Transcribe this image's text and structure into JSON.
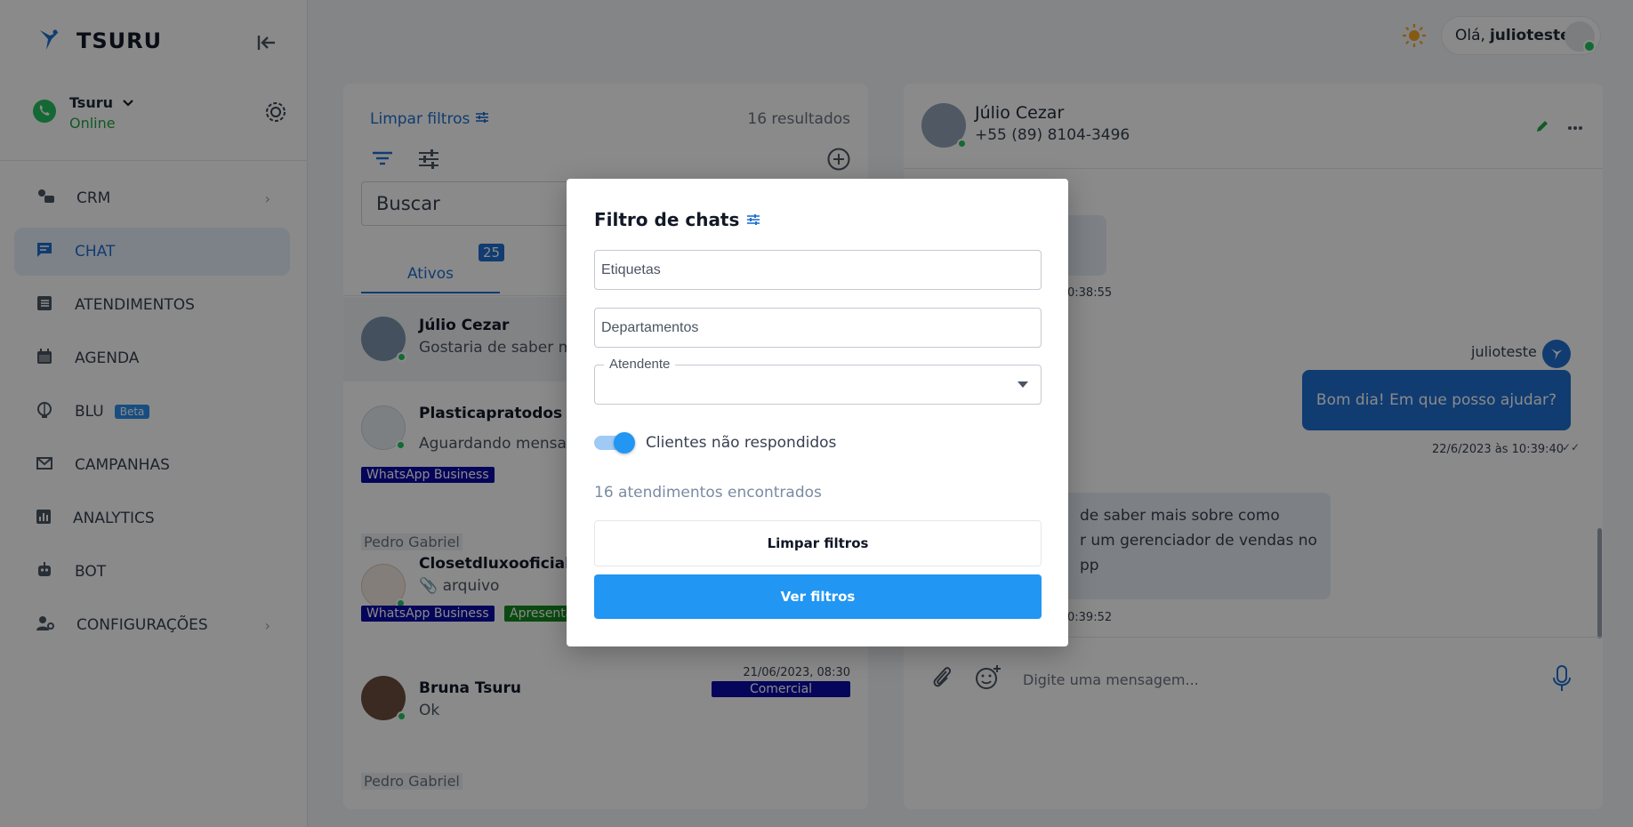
{
  "brand": {
    "name": "TSURU"
  },
  "account": {
    "name": "Tsuru",
    "status": "Online"
  },
  "nav": [
    {
      "label": "CRM",
      "icon": "crm-icon",
      "chevron": true
    },
    {
      "label": "CHAT",
      "icon": "chat-icon",
      "active": true
    },
    {
      "label": "ATENDIMENTOS",
      "icon": "list-icon"
    },
    {
      "label": "AGENDA",
      "icon": "calendar-icon"
    },
    {
      "label": "BLU",
      "icon": "brain-icon",
      "badge": "Beta"
    },
    {
      "label": "CAMPANHAS",
      "icon": "mail-icon"
    },
    {
      "label": "ANALYTICS",
      "icon": "analytics-icon"
    },
    {
      "label": "BOT",
      "icon": "bot-icon"
    },
    {
      "label": "CONFIGURAÇÕES",
      "icon": "users-gear-icon",
      "chevron": true
    }
  ],
  "header": {
    "greeting": "Olá,",
    "username": "julioteste"
  },
  "list": {
    "clear_filters": "Limpar filtros",
    "results": "16 resultados",
    "search_placeholder": "Buscar",
    "tab_active": "Ativos",
    "tab_active_count": "25",
    "chats": [
      {
        "name": "Júlio Cezar",
        "message": "Gostaria de saber ma"
      },
      {
        "name": "Plasticapratodos",
        "message": "Aguardando mensage",
        "tags": [
          "WhatsApp Business"
        ]
      },
      {
        "agent": "Pedro Gabriel",
        "name": "Closetdluxooficial",
        "message": "arquivo",
        "tags": [
          "WhatsApp Business",
          "Apresenta"
        ]
      },
      {
        "name": "Bruna Tsuru",
        "message": "Ok",
        "date": "21/06/2023, 08:30",
        "department": "Comercial"
      },
      {
        "agent": "Pedro Gabriel"
      }
    ]
  },
  "conversation": {
    "name": "Júlio Cezar",
    "phone": "+55 (89) 8104-3496",
    "msg1_fragment": "!",
    "msg1_time": "0:38:55",
    "sender": "julioteste",
    "out_message": "Bom dia! Em que posso ajudar?",
    "out_time": "22/6/2023 às 10:39:40",
    "msg2_lines": [
      "de saber mais sobre como",
      "r um gerenciador de vendas no",
      "pp"
    ],
    "msg2_time": "0:39:52",
    "composer_placeholder": "Digite uma mensagem..."
  },
  "modal": {
    "title": "Filtro de chats",
    "tags_placeholder": "Etiquetas",
    "departments_placeholder": "Departamentos",
    "attendant_label": "Atendente",
    "toggle_label": "Clientes não respondidos",
    "toggle_on": true,
    "found_text": "16 atendimentos encontrados",
    "clear_button": "Limpar filtros",
    "apply_button": "Ver filtros"
  },
  "colors": {
    "primary": "#2196f3",
    "accent": "#1f6fd1",
    "online": "#22c55e"
  }
}
